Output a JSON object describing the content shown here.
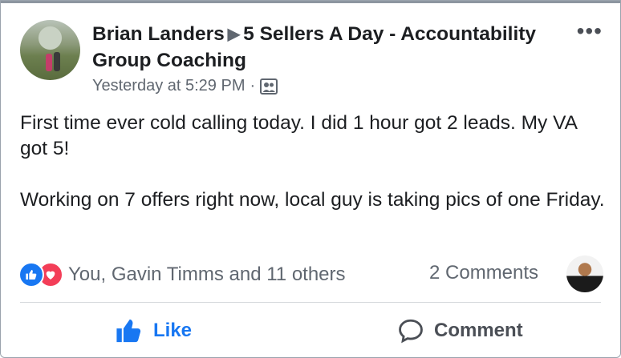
{
  "post": {
    "author": "Brian Landers",
    "group": "5 Sellers A Day - Accountability Group Coaching",
    "timestamp": "Yesterday at 5:29 PM",
    "audience_icon": "group-icon",
    "text_paragraphs": [
      "First time ever cold calling today. I did 1 hour got 2 leads. My VA got 5!",
      "Working on 7 offers right now, local guy is taking pics of one Friday."
    ]
  },
  "stats": {
    "reactions_text": "You, Gavin Timms and 11 others",
    "comments_text": "2 Comments",
    "reaction_icons": [
      "like-icon",
      "love-icon"
    ]
  },
  "actions": {
    "like_label": "Like",
    "comment_label": "Comment"
  },
  "colors": {
    "brand_blue": "#1877f2",
    "love_red": "#f33e58",
    "secondary_text": "#606770"
  }
}
